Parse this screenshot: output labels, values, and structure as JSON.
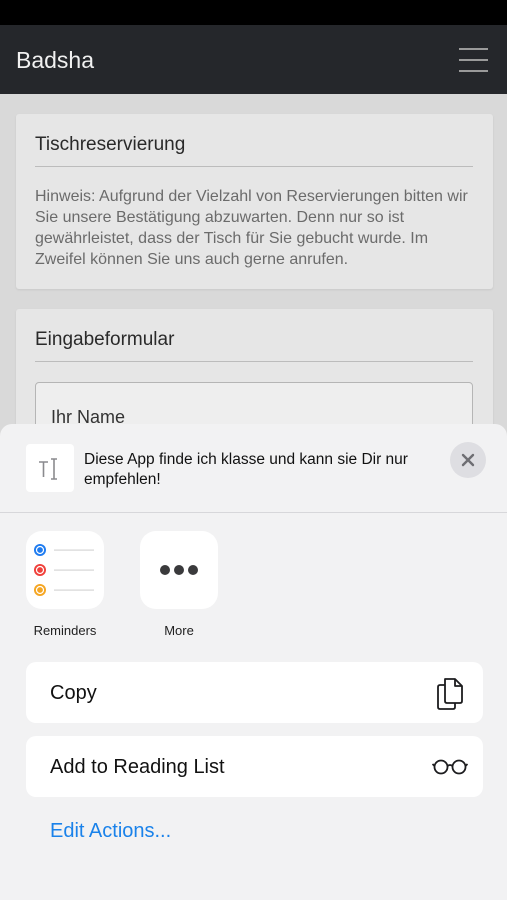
{
  "navbar": {
    "brand": "Badsha"
  },
  "reservation_card": {
    "title": "Tischreservierung",
    "notice": "Hinweis: Aufgrund der Vielzahl von Reservierungen bitten wir Sie unsere Bestätigung abzuwarten. Denn nur so ist gewährleistet, dass der Tisch für Sie gebucht wurde. Im Zweifel können Sie uns auch gerne anrufen."
  },
  "form_card": {
    "title": "Eingabeformular",
    "name_placeholder": "Ihr Name"
  },
  "share_sheet": {
    "preview_text": "Diese App finde ich klasse und kann sie Dir nur empfehlen!",
    "apps": [
      {
        "label": "Reminders",
        "icon": "reminders-icon"
      },
      {
        "label": "More",
        "icon": "more-icon"
      }
    ],
    "actions": [
      {
        "label": "Copy",
        "icon": "copy-icon"
      },
      {
        "label": "Add to Reading List",
        "icon": "glasses-icon"
      }
    ],
    "edit_actions": "Edit Actions...",
    "colors": {
      "reminder_blue": "#1f7cf0",
      "reminder_red": "#f0413b",
      "reminder_orange": "#f5a623",
      "link_blue": "#1a82ea"
    }
  }
}
